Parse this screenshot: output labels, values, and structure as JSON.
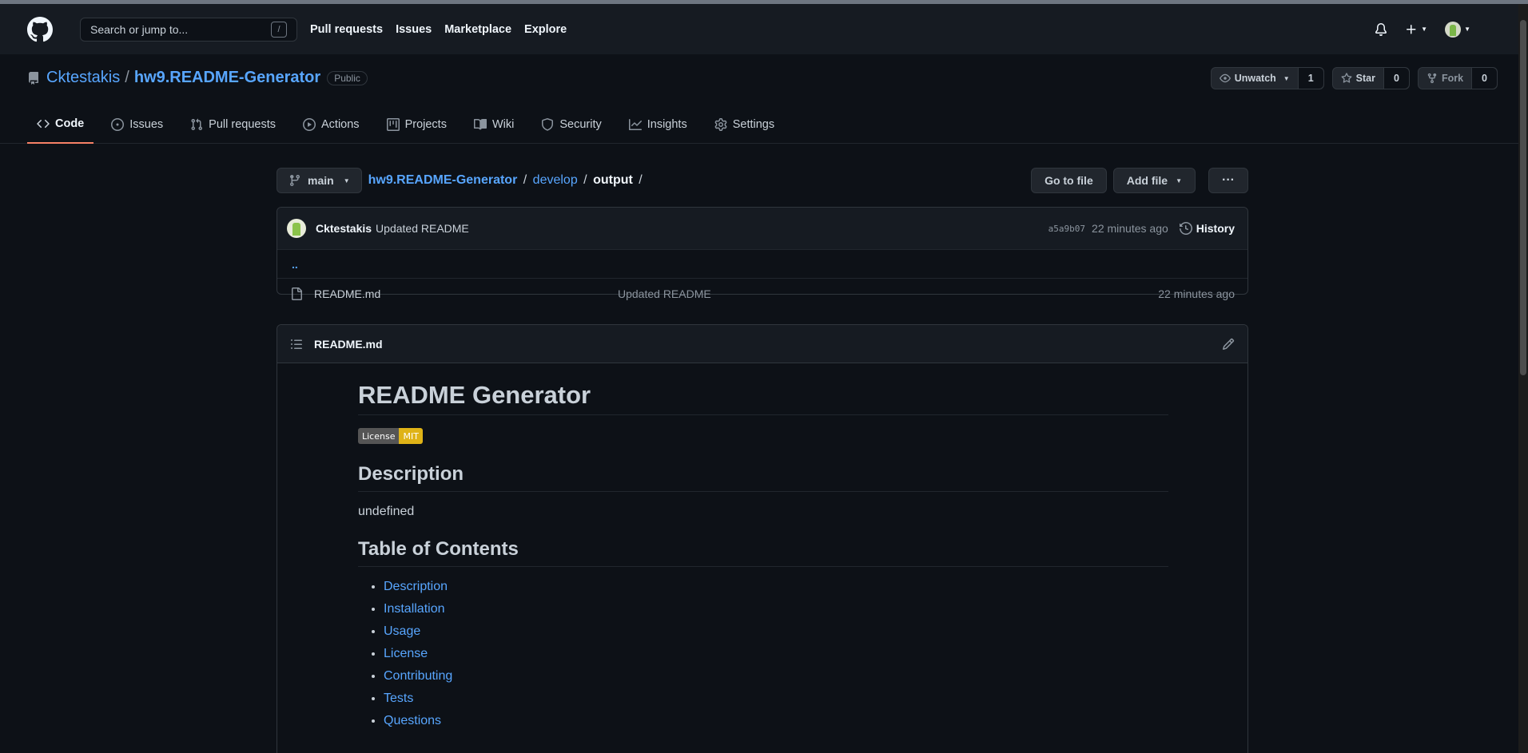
{
  "header": {
    "search_placeholder": "Search or jump to...",
    "search_shortcut": "/",
    "nav": [
      "Pull requests",
      "Issues",
      "Marketplace",
      "Explore"
    ]
  },
  "repo": {
    "owner": "Cktestakis",
    "separator": "/",
    "name": "hw9.README-Generator",
    "visibility": "Public",
    "watch_label": "Unwatch",
    "watch_count": "1",
    "star_label": "Star",
    "star_count": "0",
    "fork_label": "Fork",
    "fork_count": "0"
  },
  "tabs": [
    {
      "label": "Code",
      "icon": "code-icon"
    },
    {
      "label": "Issues",
      "icon": "issue-icon"
    },
    {
      "label": "Pull requests",
      "icon": "pull-request-icon"
    },
    {
      "label": "Actions",
      "icon": "play-icon"
    },
    {
      "label": "Projects",
      "icon": "project-icon"
    },
    {
      "label": "Wiki",
      "icon": "book-icon"
    },
    {
      "label": "Security",
      "icon": "shield-icon"
    },
    {
      "label": "Insights",
      "icon": "graph-icon"
    },
    {
      "label": "Settings",
      "icon": "gear-icon"
    }
  ],
  "filenav": {
    "branch": "main",
    "crumb_repo": "hw9.README-Generator",
    "crumb_folder": "develop",
    "crumb_current": "output",
    "sep": "/",
    "go_to_file": "Go to file",
    "add_file": "Add file",
    "more": "···"
  },
  "commit": {
    "author": "Cktestakis",
    "message": "Updated README",
    "sha": "a5a9b07",
    "time": "22 minutes ago",
    "history_label": "History"
  },
  "files": {
    "up": "..",
    "rows": [
      {
        "name": "README.md",
        "message": "Updated README",
        "time": "22 minutes ago"
      }
    ]
  },
  "readme": {
    "filename": "README.md",
    "title": "README Generator",
    "badge_left": "License",
    "badge_right": "MIT",
    "h_description": "Description",
    "description": "undefined",
    "h_toc": "Table of Contents",
    "toc": [
      "Description",
      "Installation",
      "Usage",
      "License",
      "Contributing",
      "Tests",
      "Questions"
    ]
  },
  "colors": {
    "background": "#0d1117",
    "header": "#161b22",
    "link": "#58a6ff",
    "tab_underline": "#f78166",
    "badge_mit": "#dfb317"
  }
}
